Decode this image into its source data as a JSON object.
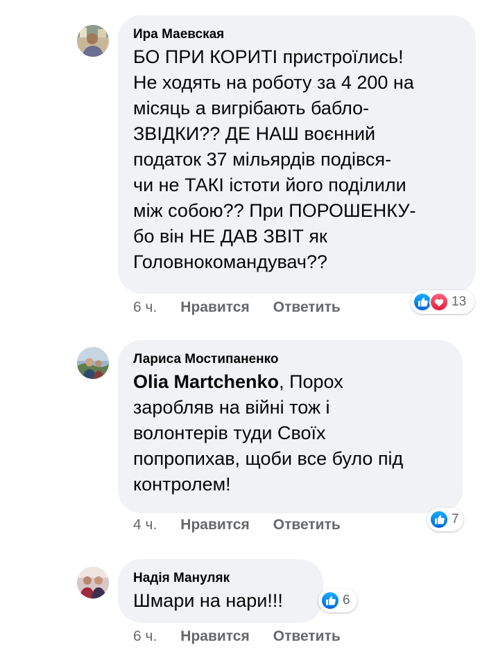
{
  "comments": [
    {
      "author": "Ира Маевская",
      "text": "БО ПРИ КОРИТІ пристроїлись!\nНе ходять на роботу за 4 200 на\nмісяць а вигрібають бабло-\nЗВІДКИ?? ДЕ НАШ воєнний\nподаток 37 мільярдів подівся-\nчи не ТАКІ істоти його поділили\nміж собою?? При ПОРОШЕНКУ-\nбо він НЕ ДАВ ЗВІТ як\nГоловнокомандувач??",
      "time": "6 ч.",
      "like_label": "Нравится",
      "reply_label": "Ответить",
      "reaction_count": "13",
      "reaction_icons": [
        "like-icon",
        "love-icon"
      ]
    },
    {
      "author": "Лариса Мостипаненко",
      "mention": "Olia Martchenko",
      "text": ", Порох\nзаробляв на війні тож і\nволонтерів туди Своїх\nпопропихав, щоби все було під\nконтролем!",
      "time": "4 ч.",
      "like_label": "Нравится",
      "reply_label": "Ответить",
      "reaction_count": "7",
      "reaction_icons": [
        "like-icon"
      ]
    },
    {
      "author": "Надія Мануляк",
      "text": "Шмари на нари!!!",
      "time": "6 ч.",
      "like_label": "Нравится",
      "reply_label": "Ответить",
      "reaction_count": "6",
      "reaction_icons": [
        "like-icon"
      ]
    }
  ],
  "colors": {
    "bubble": "#f0f2f5",
    "meta_text": "#65676b",
    "like_blue": "#1877f2",
    "love_red": "#f33e58"
  }
}
